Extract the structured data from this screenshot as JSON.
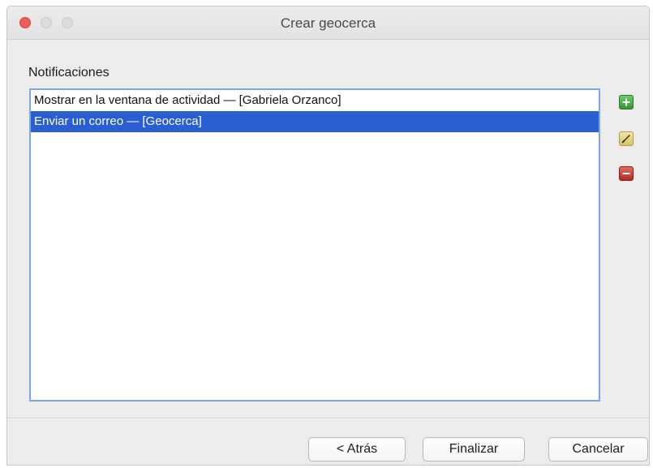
{
  "window": {
    "title": "Crear geocerca"
  },
  "notifications": {
    "label": "Notificaciones",
    "items": [
      {
        "text": "Mostrar en la ventana de actividad — [Gabriela Orzanco]",
        "selected": false
      },
      {
        "text": "Enviar un correo — [Geocerca]",
        "selected": true
      }
    ]
  },
  "side_buttons": {
    "add_icon": "plus-icon",
    "edit_icon": "pencil-icon",
    "remove_icon": "minus-icon"
  },
  "footer": {
    "back_label": "< Atrás",
    "finish_label": "Finalizar",
    "cancel_label": "Cancelar"
  },
  "colors": {
    "selection": "#2a5fd1",
    "add": "#3aa23a",
    "edit": "#d9c26a",
    "remove": "#c0302a",
    "close_button": "#ee5d58"
  }
}
